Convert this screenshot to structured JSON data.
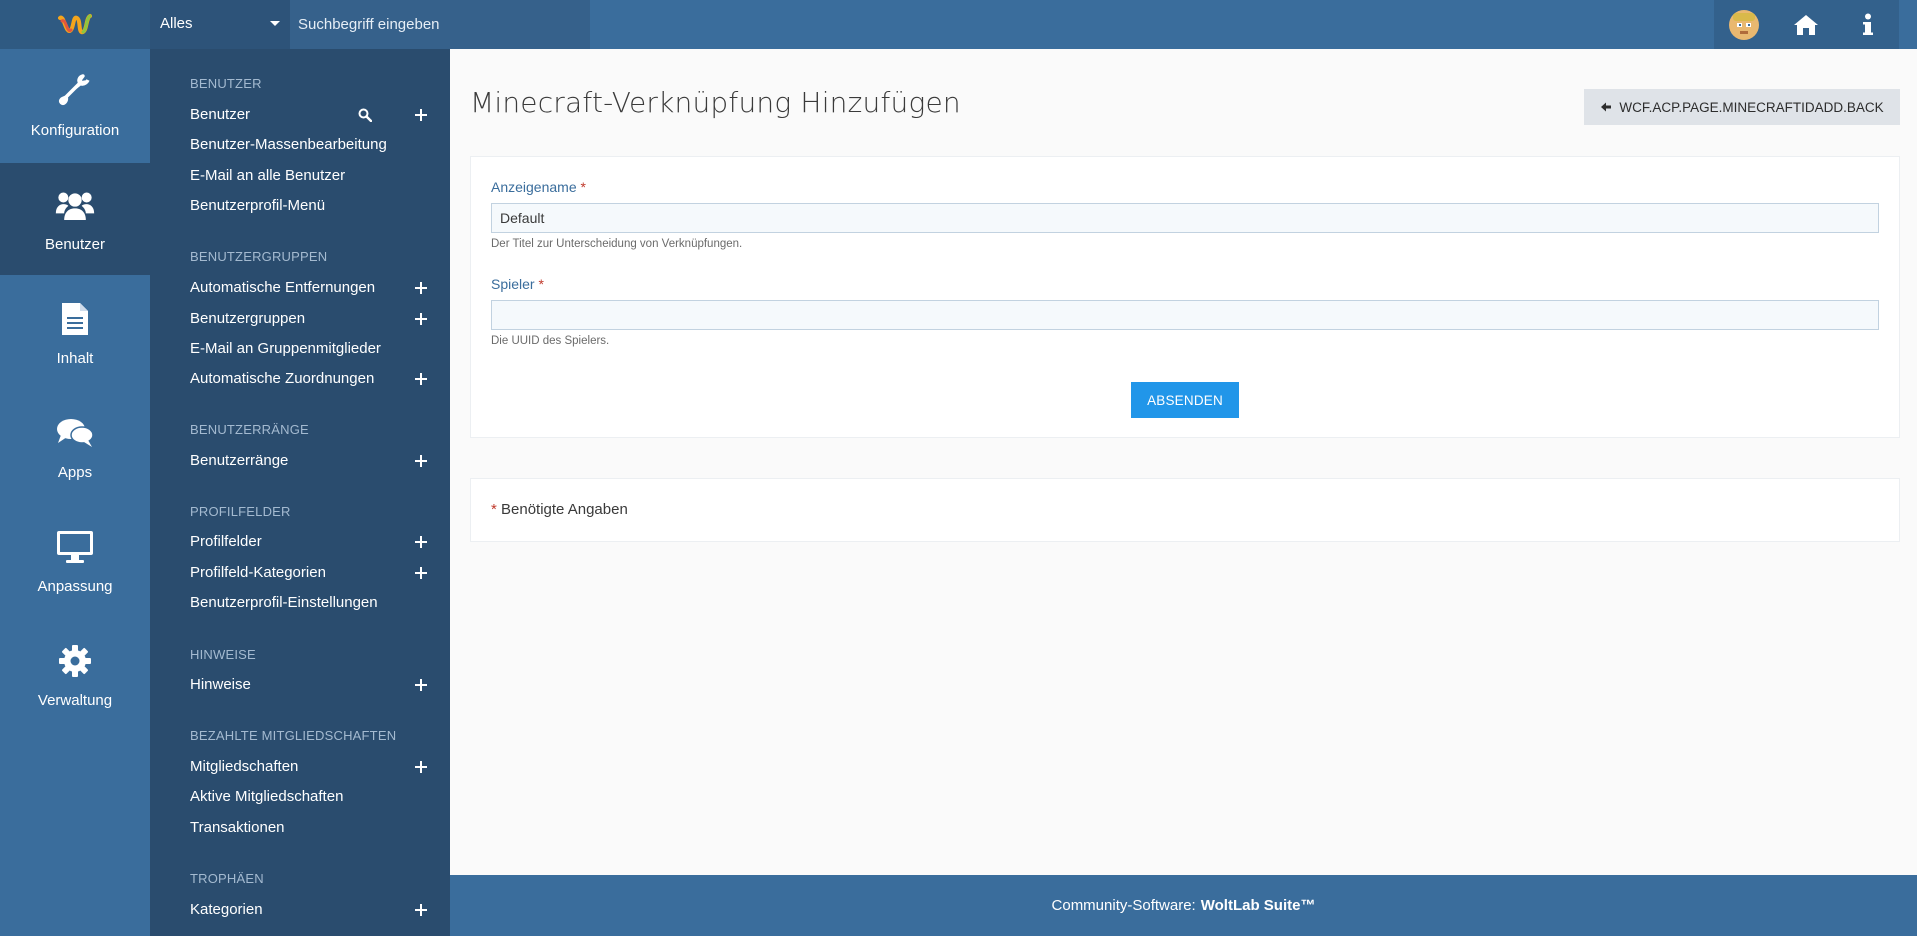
{
  "header": {
    "search_scope": "Alles",
    "search_placeholder": "Suchbegriff eingeben"
  },
  "sidebar_icons": [
    {
      "label": "Konfiguration",
      "icon": "wrench-icon"
    },
    {
      "label": "Benutzer",
      "icon": "users-icon",
      "active": true
    },
    {
      "label": "Inhalt",
      "icon": "document-icon"
    },
    {
      "label": "Apps",
      "icon": "comments-icon"
    },
    {
      "label": "Anpassung",
      "icon": "monitor-icon"
    },
    {
      "label": "Verwaltung",
      "icon": "gear-icon"
    }
  ],
  "submenu": {
    "sections": [
      {
        "title": "Benutzer",
        "items": [
          {
            "label": "Benutzer",
            "search": true,
            "add": true
          },
          {
            "label": "Benutzer-Massenbearbeitung"
          },
          {
            "label": "E-Mail an alle Benutzer"
          },
          {
            "label": "Benutzerprofil-Menü"
          }
        ]
      },
      {
        "title": "Benutzergruppen",
        "items": [
          {
            "label": "Automatische Entfernungen",
            "add": true
          },
          {
            "label": "Benutzergruppen",
            "add": true
          },
          {
            "label": "E-Mail an Gruppenmitglieder"
          },
          {
            "label": "Automatische Zuordnungen",
            "add": true
          }
        ]
      },
      {
        "title": "Benutzerränge",
        "items": [
          {
            "label": "Benutzerränge",
            "add": true
          }
        ]
      },
      {
        "title": "Profilfelder",
        "items": [
          {
            "label": "Profilfelder",
            "add": true
          },
          {
            "label": "Profilfeld-Kategorien",
            "add": true
          },
          {
            "label": "Benutzerprofil-Einstellungen"
          }
        ]
      },
      {
        "title": "Hinweise",
        "items": [
          {
            "label": "Hinweise",
            "add": true
          }
        ]
      },
      {
        "title": "Bezahlte Mitgliedschaften",
        "items": [
          {
            "label": "Mitgliedschaften",
            "add": true
          },
          {
            "label": "Aktive Mitgliedschaften"
          },
          {
            "label": "Transaktionen"
          }
        ]
      },
      {
        "title": "Trophäen",
        "items": [
          {
            "label": "Kategorien",
            "add": true
          }
        ]
      }
    ]
  },
  "main": {
    "title": "Minecraft-Verknüpfung Hinzufügen",
    "back_label": "WCF.ACP.PAGE.MINECRAFTIDADD.BACK",
    "fields": {
      "name": {
        "label": "Anzeigename",
        "required": "*",
        "value": "Default",
        "help": "Der Titel zur Unterscheidung von Verknüpfungen."
      },
      "player": {
        "label": "Spieler",
        "required": "*",
        "value": "",
        "help": "Die UUID des Spielers."
      }
    },
    "submit_label": "ABSENDEN",
    "required_marker": "*",
    "required_note": "Benötigte Angaben"
  },
  "footer": {
    "prefix": "Community-Software:",
    "brand": "WoltLab Suite™"
  },
  "colors": {
    "header": "#3a6d9c",
    "sidebar_active": "#2a4c6e",
    "submit": "#2196e9",
    "required": "#c0392b"
  }
}
